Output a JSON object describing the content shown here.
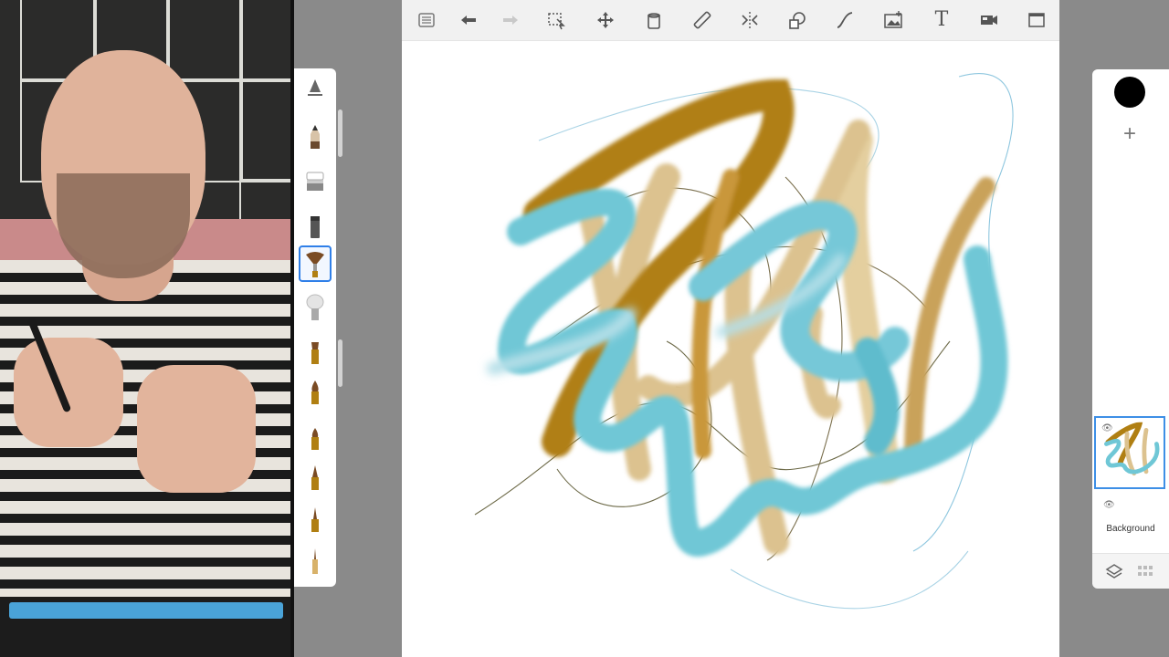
{
  "app": {
    "top_toolbar": {
      "tools": [
        {
          "id": "menu",
          "icon": "list-icon"
        },
        {
          "id": "undo",
          "icon": "undo-arrow-icon"
        },
        {
          "id": "redo",
          "icon": "redo-arrow-icon"
        },
        {
          "id": "selection",
          "icon": "selection-icon"
        },
        {
          "id": "transform",
          "icon": "transform-move-icon"
        },
        {
          "id": "fill",
          "icon": "fill-bucket-icon"
        },
        {
          "id": "ruler",
          "icon": "ruler-icon"
        },
        {
          "id": "symmetry",
          "icon": "symmetry-icon"
        },
        {
          "id": "shape",
          "icon": "shape-icon"
        },
        {
          "id": "stroke",
          "icon": "curve-stroke-icon"
        },
        {
          "id": "image",
          "icon": "image-insert-icon"
        },
        {
          "id": "text",
          "icon": "text-tool-icon",
          "glyph": "T"
        },
        {
          "id": "record",
          "icon": "camera-record-icon"
        },
        {
          "id": "fullscreen",
          "icon": "fullscreen-icon"
        }
      ]
    },
    "brush_library": {
      "brushes": [
        {
          "id": "brush-properties",
          "icon": "brush-properties-icon"
        },
        {
          "id": "pencil",
          "icon": "pencil-brush-icon"
        },
        {
          "id": "eraser",
          "icon": "eraser-brush-icon"
        },
        {
          "id": "marker",
          "icon": "marker-brush-icon"
        },
        {
          "id": "fan",
          "icon": "fan-brush-icon",
          "selected": true
        },
        {
          "id": "soft",
          "icon": "soft-brush-icon"
        },
        {
          "id": "chisel",
          "icon": "chisel-brush-icon"
        },
        {
          "id": "round-1",
          "icon": "round-brush-icon"
        },
        {
          "id": "round-2",
          "icon": "round-brush-icon"
        },
        {
          "id": "pointed",
          "icon": "pointed-brush-icon"
        },
        {
          "id": "liner",
          "icon": "liner-brush-icon"
        },
        {
          "id": "pen",
          "icon": "pen-brush-icon"
        }
      ]
    },
    "layers": {
      "current_color": "#000000",
      "add_label": "+",
      "background_label": "Background"
    },
    "colors": {
      "ochre": "#b07f12",
      "sand": "#dcc28f",
      "teal": "#6fc7d6",
      "selection_blue": "#2f7fe8"
    }
  }
}
